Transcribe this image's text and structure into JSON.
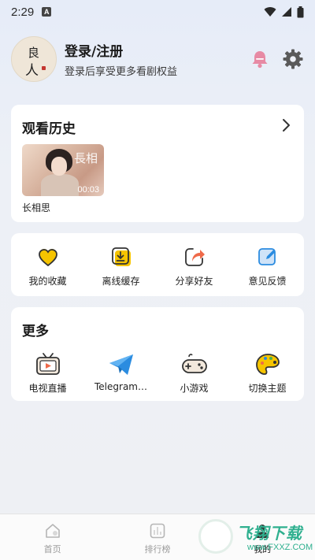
{
  "status_bar": {
    "time": "2:29",
    "notification": "A"
  },
  "profile": {
    "avatar_chars": [
      "良",
      "人"
    ],
    "title": "登录/注册",
    "subtitle": "登录后享受更多看剧权益",
    "icons": [
      "bell-icon",
      "gear-icon"
    ]
  },
  "history": {
    "title": "观看历史",
    "items": [
      {
        "title": "长相思",
        "duration": "00:03",
        "cover_text": "長相"
      }
    ]
  },
  "actions": [
    {
      "label": "我的收藏",
      "icon": "heart-icon"
    },
    {
      "label": "离线缓存",
      "icon": "download-icon"
    },
    {
      "label": "分享好友",
      "icon": "share-icon"
    },
    {
      "label": "意见反馈",
      "icon": "feedback-icon"
    }
  ],
  "more": {
    "title": "更多",
    "items": [
      {
        "label": "电视直播",
        "icon": "tv-icon"
      },
      {
        "label": "Telegram…",
        "icon": "telegram-icon"
      },
      {
        "label": "小游戏",
        "icon": "gamepad-icon"
      },
      {
        "label": "切换主题",
        "icon": "palette-icon"
      }
    ]
  },
  "tabbar": {
    "tabs": [
      {
        "label": "首页",
        "icon": "home-icon"
      },
      {
        "label": "排行榜",
        "icon": "ranking-icon"
      },
      {
        "label": "我的",
        "icon": "profile-icon"
      }
    ],
    "active": "我的"
  },
  "watermark": {
    "text": "飞翔下载",
    "url": "www.FXXZ.COM"
  },
  "colors": {
    "accent_yellow": "#f6c400",
    "accent_blue": "#2b8ce0",
    "accent_pink": "#f07a9a",
    "watermark_green": "#2fb08f"
  }
}
